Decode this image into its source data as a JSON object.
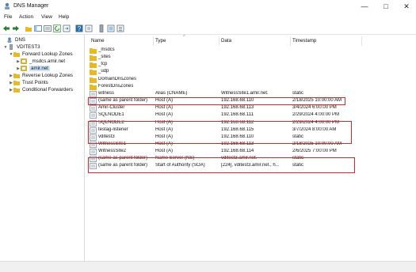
{
  "window": {
    "title": "DNS Manager"
  },
  "menu": {
    "file": "File",
    "action": "Action",
    "view": "View",
    "help": "Help"
  },
  "tree": {
    "root": "DNS",
    "server": "VDITEST3",
    "forward": "Forward Lookup Zones",
    "msdcs_zone": "_msdcs.amir.net",
    "amir_zone": "amir.net",
    "reverse": "Reverse Lookup Zones",
    "trust": "Trust Points",
    "conditional": "Conditional Forwarders"
  },
  "columns": {
    "name": "Name",
    "type": "Type",
    "data": "Data",
    "timestamp": "Timestamp"
  },
  "rows": [
    {
      "name": "_msdcs",
      "type": "",
      "data": "",
      "ts": ""
    },
    {
      "name": "_sites",
      "type": "",
      "data": "",
      "ts": ""
    },
    {
      "name": "_tcp",
      "type": "",
      "data": "",
      "ts": ""
    },
    {
      "name": "_udp",
      "type": "",
      "data": "",
      "ts": ""
    },
    {
      "name": "DomainDnsZones",
      "type": "",
      "data": "",
      "ts": ""
    },
    {
      "name": "ForestDnsZones",
      "type": "",
      "data": "",
      "ts": ""
    },
    {
      "name": "witness",
      "type": "Alias (CNAME)",
      "data": "WitnessSite1.amir.net.",
      "ts": "static"
    },
    {
      "name": "(same as parent folder)",
      "type": "Host (A)",
      "data": "192.168.68.110",
      "ts": "2/18/2025 10:00:00 AM"
    },
    {
      "name": "Amir-Cluster",
      "type": "Host (A)",
      "data": "192.168.68.113",
      "ts": "3/4/2024 6:00:00 PM"
    },
    {
      "name": "SQLNODE1",
      "type": "Host (A)",
      "data": "192.168.68.111",
      "ts": "2/29/2024 4:00:00 PM"
    },
    {
      "name": "SQLNODE2",
      "type": "Host (A)",
      "data": "192.168.68.112",
      "ts": "2/29/2024 4:00:00 PM"
    },
    {
      "name": "testag-listener",
      "type": "Host (A)",
      "data": "192.168.68.115",
      "ts": "3/7/2024 8:00:00 AM"
    },
    {
      "name": "vditest3",
      "type": "Host (A)",
      "data": "192.168.68.110",
      "ts": "static"
    },
    {
      "name": "WitnessSite1",
      "type": "Host (A)",
      "data": "192.168.68.113",
      "ts": "2/18/2025 10:00:00 AM"
    },
    {
      "name": "WitnessSite2",
      "type": "Host (A)",
      "data": "192.168.68.114",
      "ts": "2/6/2025 7:00:00 PM"
    },
    {
      "name": "(same as parent folder)",
      "type": "Name Server (NS)",
      "data": "vditest3.amir.net.",
      "ts": "static"
    },
    {
      "name": "(same as parent folder)",
      "type": "Start of Authority (SOA)",
      "data": "[224], vditest3.amir.net., h...",
      "ts": "static"
    }
  ],
  "colors": {
    "highlight": "#d9232e",
    "selection": "#cce4f7",
    "folder": "#e8b923"
  }
}
